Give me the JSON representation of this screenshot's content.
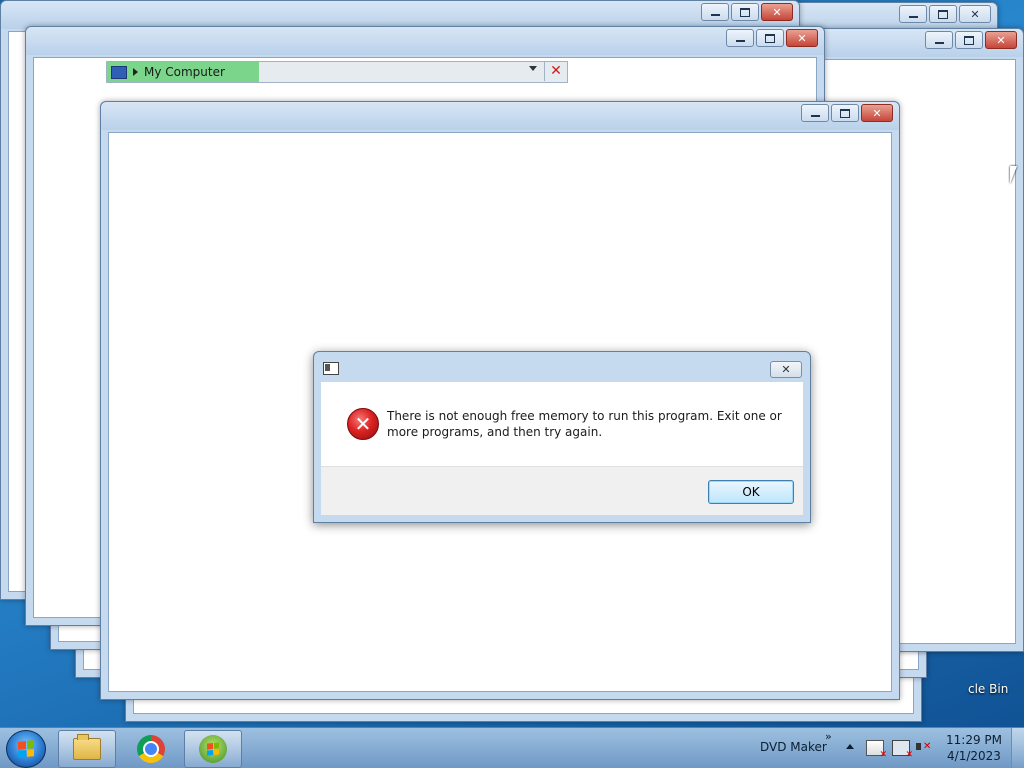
{
  "desktop": {
    "recycle_bin_label": "cle Bin"
  },
  "address_bar": {
    "location": "My Computer",
    "progress": 0.33
  },
  "dialog": {
    "message": "There is not enough free memory to run this program. Exit one or more programs, and then try again.",
    "ok_label": "OK"
  },
  "taskbar": {
    "toolbar_label": "DVD Maker",
    "chevron": "»",
    "time": "11:29 PM",
    "date": "4/1/2023"
  },
  "icons": [
    "start-orb-icon",
    "folder-icon",
    "chrome-icon",
    "windows-orb-icon",
    "action-center-icon",
    "network-icon",
    "volume-icon",
    "error-icon"
  ],
  "colors": {
    "window_frame": "#c5d9ef",
    "close_button": "#c6453a",
    "progress": "#7bd58a",
    "error": "#d22222"
  }
}
